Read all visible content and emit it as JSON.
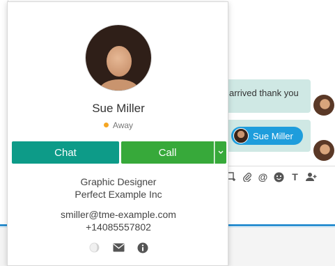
{
  "chat_background": {
    "message_1": "arrived thank you",
    "mention_chip": "Sue Miller",
    "toolbar_icons": [
      "add-frame-icon",
      "attach-icon",
      "at-icon",
      "emoji-icon",
      "text-format-icon",
      "add-user-icon"
    ],
    "toolbar_glyphs": [
      "⊞",
      "📎",
      "@",
      "☻",
      "T",
      "👤+"
    ]
  },
  "contact_card": {
    "name": "Sue Miller",
    "status": "Away",
    "status_color": "#f5a623",
    "chat_button": "Chat",
    "call_button": "Call",
    "call_dropdown": "⌄",
    "title": "Graphic Designer",
    "company": "Perfect Example Inc",
    "email": "smiller@tme-example.com",
    "phone": "+14085557802",
    "chat_color": "#0d9b88",
    "call_color": "#37a93a"
  }
}
